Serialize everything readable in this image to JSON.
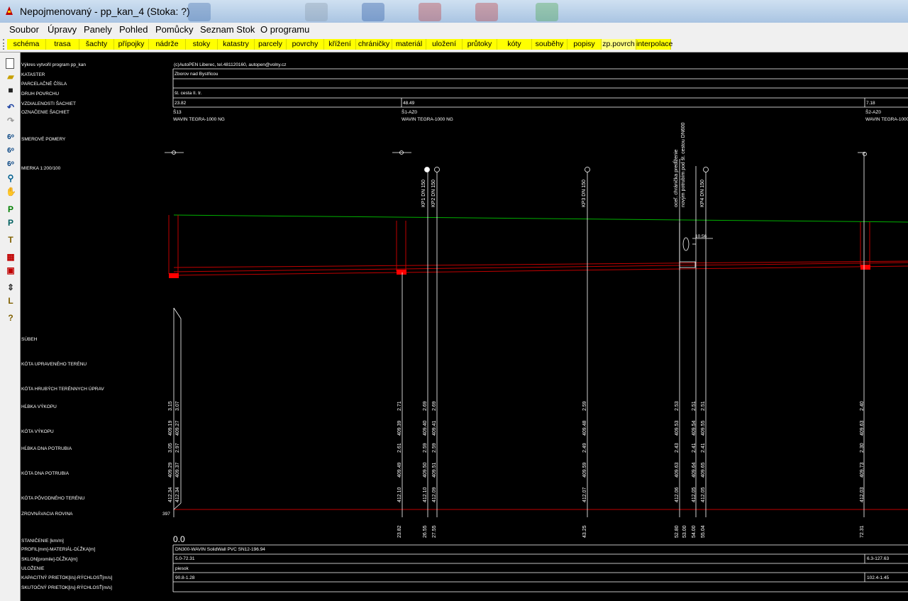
{
  "window": {
    "title": "Nepojmenovaný - pp_kan_4 (Stoka: ?)"
  },
  "menu": [
    "Soubor",
    "Úpravy",
    "Panely",
    "Pohled",
    "Pomůcky",
    "Seznam Stok",
    "O programu"
  ],
  "toolbar": [
    "schéma",
    "trasa",
    "šachty",
    "přípojky",
    "nádrže",
    "stoky",
    "katastry",
    "parcely",
    "povrchy",
    "křížení",
    "chráničky",
    "materiál",
    "uložení",
    "průtoky",
    "kóty",
    "souběhy",
    "popisy",
    "zp.povrch",
    "interpolace"
  ],
  "left_tools": [
    "new-file-icon",
    "open-folder-icon",
    "save-icon",
    "undo-icon",
    "redo-icon",
    "glasses-icon",
    "glasses-icon",
    "glasses-icon",
    "zoom-icon",
    "hand-icon",
    "letter-p-icon",
    "letter-p-icon",
    "letter-t-icon",
    "red-grid-icon",
    "red-box-icon",
    "updown-icon",
    "letter-l-icon",
    "help-icon"
  ],
  "header_rows": {
    "author_label": "Výkres vytvořil program pp_kan",
    "author_value": "(c)AutoPEN Liberec, tel.481120160, autopen@volny.cz",
    "cadastre_label": "KATASTER",
    "cadastre_value": "Zborov nad Bystřicou",
    "parcel_label": "PARCELAČNÉ ČÍSLA",
    "surface_label": "DRUH POVRCHU",
    "surface_value": "št. cesta II. tr.",
    "distances_label": "VZDIALENOSTI ŠACHIET",
    "distances": [
      "23.82",
      "48.49",
      "7.18"
    ],
    "manholes_label": "OZNAČENIE ŠACHIET",
    "manholes": [
      {
        "id": "Š13",
        "type": "WAVIN TEGRA-1000 NG"
      },
      {
        "id": "Š1-AZ0",
        "type": "WAVIN TEGRA-1000 NG"
      },
      {
        "id": "Š2-AZ0",
        "type": "WAVIN TEGRA-1000 NG"
      }
    ],
    "direction_label": "SMEROVÉ POMERY",
    "scale_label": "MIERKA 1:200/100"
  },
  "pipe_labels": [
    "KP1 DN 150",
    "KP2 DN 150",
    "KP3 DN 150",
    "KP4 DN 150"
  ],
  "crossing_label": "oceľ. chránička predĺženie",
  "crossing_label2": "novým potrubím pod št. cestou DN600",
  "dim_value": "10.56",
  "bottom_labels": {
    "parallel": "SÚBEH",
    "finished_level": "KÓTA UPRAVENÉHO TERÉNU",
    "rough_level": "KÓTA HRUBÝCH TERÉNNYCH ÚPRAV",
    "excavation_depth": "HĹBKA VÝKOPU",
    "excavation_level": "KÓTA VÝKOPU",
    "pipe_bottom_depth": "HĹBKA DNA POTRUBIA",
    "pipe_bottom_level": "KÓTA DNA POTRUBIA",
    "original_level": "KÓTA PÔVODNÉHO TERÉNU",
    "datum": "ZROVNÁVACIA ROVINA",
    "datum_value": "397",
    "station": "STANIČENIE [km/m]",
    "station_start": "0.0",
    "profile": "PROFIL[mm]-MATERIÁL-DĹŽKA[m]",
    "profile_value": "DN300-WAVIN SolidWall PVC SN12-196.94",
    "slope": "SKLON[promile]-DĹŽKA[m]",
    "slope_values": [
      "5.0-72.31",
      "6.3-127.63"
    ],
    "bedding": "ULOŽENIE",
    "bedding_value": "piesok",
    "capacity": "KAPACITNÝ PRIETOK[l/s]-RÝCHLOSŤ[m/s]",
    "capacity_values": [
      "90.8-1.28",
      "102.4-1.45"
    ],
    "actual": "SKUTOČNÝ PRIETOK[l/s]-RÝCHLOSŤ[m/s]"
  },
  "columns": [
    {
      "excav_depth": [
        "3.15",
        "3.07"
      ],
      "excav_level": [
        "409.19",
        "409.27"
      ],
      "bottom_depth": [
        "3.05",
        "2.97"
      ],
      "bottom_level": [
        "409.29",
        "409.37"
      ],
      "orig_level": [
        "412.34",
        "412.34"
      ],
      "station": []
    },
    {
      "excav_depth": [
        "2.71"
      ],
      "excav_level": [
        "409.39"
      ],
      "bottom_depth": [
        "2.61"
      ],
      "bottom_level": [
        "409.49"
      ],
      "orig_level": [
        "412.10"
      ],
      "station": [
        "23.82"
      ]
    },
    {
      "excav_depth": [
        "2.69",
        "2.69"
      ],
      "excav_level": [
        "409.40",
        "409.41"
      ],
      "bottom_depth": [
        "2.59",
        "2.59"
      ],
      "bottom_level": [
        "409.50",
        "409.51"
      ],
      "orig_level": [
        "412.10",
        "412.09"
      ],
      "station": [
        "26.55",
        "27.55"
      ]
    },
    {
      "excav_depth": [
        "2.59"
      ],
      "excav_level": [
        "409.48"
      ],
      "bottom_depth": [
        "2.49"
      ],
      "bottom_level": [
        "409.59"
      ],
      "orig_level": [
        "412.07"
      ],
      "station": [
        "43.25"
      ]
    },
    {
      "excav_depth": [
        "2.53",
        "2.51",
        "2.51"
      ],
      "excav_level": [
        "409.53",
        "409.54",
        "409.55"
      ],
      "bottom_depth": [
        "2.43",
        "2.41",
        "2.41"
      ],
      "bottom_level": [
        "409.63",
        "409.64",
        "409.65"
      ],
      "orig_level": [
        "412.06",
        "412.05",
        "412.05"
      ],
      "station": [
        "52.80",
        "53.00",
        "54.00",
        "55.04"
      ]
    },
    {
      "excav_depth": [
        "2.40"
      ],
      "excav_level": [
        "409.63"
      ],
      "bottom_depth": [
        "2.30"
      ],
      "bottom_level": [
        "409.73"
      ],
      "orig_level": [
        "412.03"
      ],
      "station": [
        "72.31"
      ]
    }
  ]
}
